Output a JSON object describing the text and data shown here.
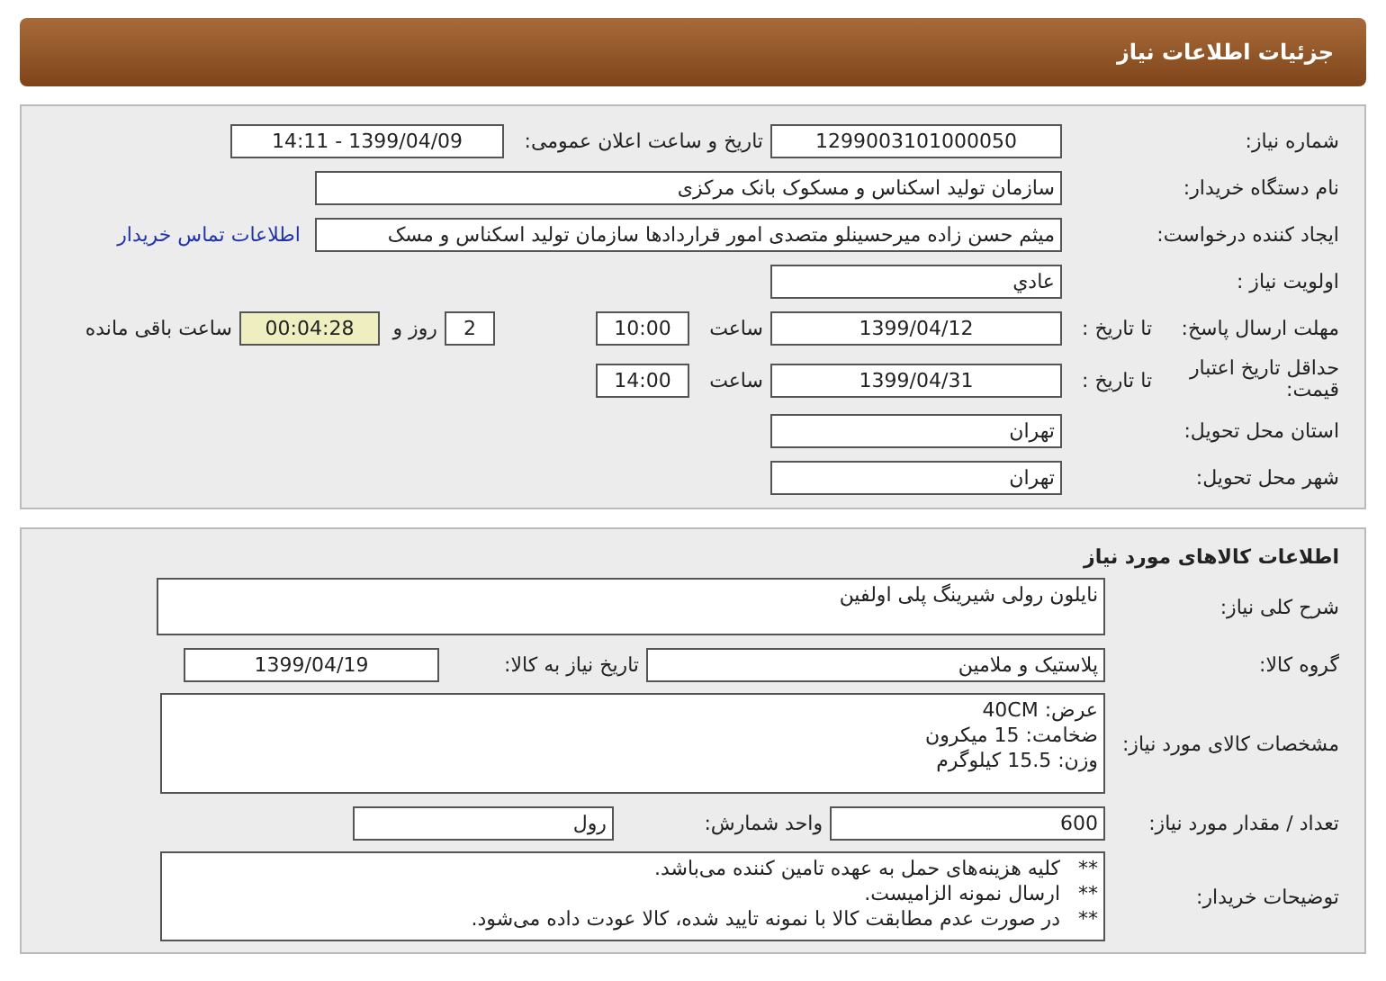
{
  "header": {
    "title": "جزئیات اطلاعات نیاز"
  },
  "need": {
    "number_label": "شماره نیاز:",
    "number": "1299003101000050",
    "announce_label": "تاریخ و ساعت اعلان عمومی:",
    "announce": "1399/04/09 - 14:11",
    "buyer_label": "نام دستگاه خریدار:",
    "buyer": "سازمان تولید اسکناس و مسکوک بانک مرکزی",
    "creator_label": "ایجاد کننده درخواست:",
    "creator": "میثم حسن زاده میرحسینلو متصدی امور قراردادها سازمان تولید اسکناس و مسک",
    "contact_link": "اطلاعات تماس خریدار",
    "priority_label": "اولویت نیاز :",
    "priority": "عادي",
    "deadline_label": "مهلت ارسال پاسخ:",
    "deadline_to": "تا تاریخ :",
    "deadline_date": "1399/04/12",
    "deadline_time_label": "ساعت",
    "deadline_time": "10:00",
    "days": "2",
    "days_label": "روز و",
    "remaining": "00:04:28",
    "remaining_label": "ساعت باقی مانده",
    "validity_label": "حداقل تاریخ اعتبار قیمت:",
    "validity_to": "تا تاریخ :",
    "validity_date": "1399/04/31",
    "validity_time_label": "ساعت",
    "validity_time": "14:00",
    "province_label": "استان محل تحویل:",
    "province": "تهران",
    "city_label": "شهر محل تحویل:",
    "city": "تهران"
  },
  "goods": {
    "title": "اطلاعات کالاهای مورد نیاز",
    "summary_label": "شرح کلی نیاز:",
    "summary": "نایلون رولی شیرینگ پلی اولفین",
    "group_label": "گروه کالا:",
    "group": "پلاستیک و ملامین",
    "need_date_label": "تاریخ نیاز به کالا:",
    "need_date": "1399/04/19",
    "specs_label": "مشخصات کالای مورد نیاز:",
    "specs": [
      "عرض: 40CM",
      "ضخامت: 15 میکرون",
      "وزن: 15.5 کیلوگرم"
    ],
    "qty_label": "تعداد / مقدار مورد نیاز:",
    "qty": "600",
    "unit_label": "واحد شمارش:",
    "unit": "رول",
    "notes_label": "توضیحات خریدار:",
    "notes": [
      {
        "mark": "**",
        "text": "کلیه هزینه‌های حمل به عهده تامین کننده می‌باشد."
      },
      {
        "mark": "**",
        "text": "ارسال نمونه الزامیست."
      },
      {
        "mark": "**",
        "text": "در صورت عدم مطابقت کالا با نمونه تایید شده، کالا عودت داده می‌شود."
      }
    ]
  }
}
